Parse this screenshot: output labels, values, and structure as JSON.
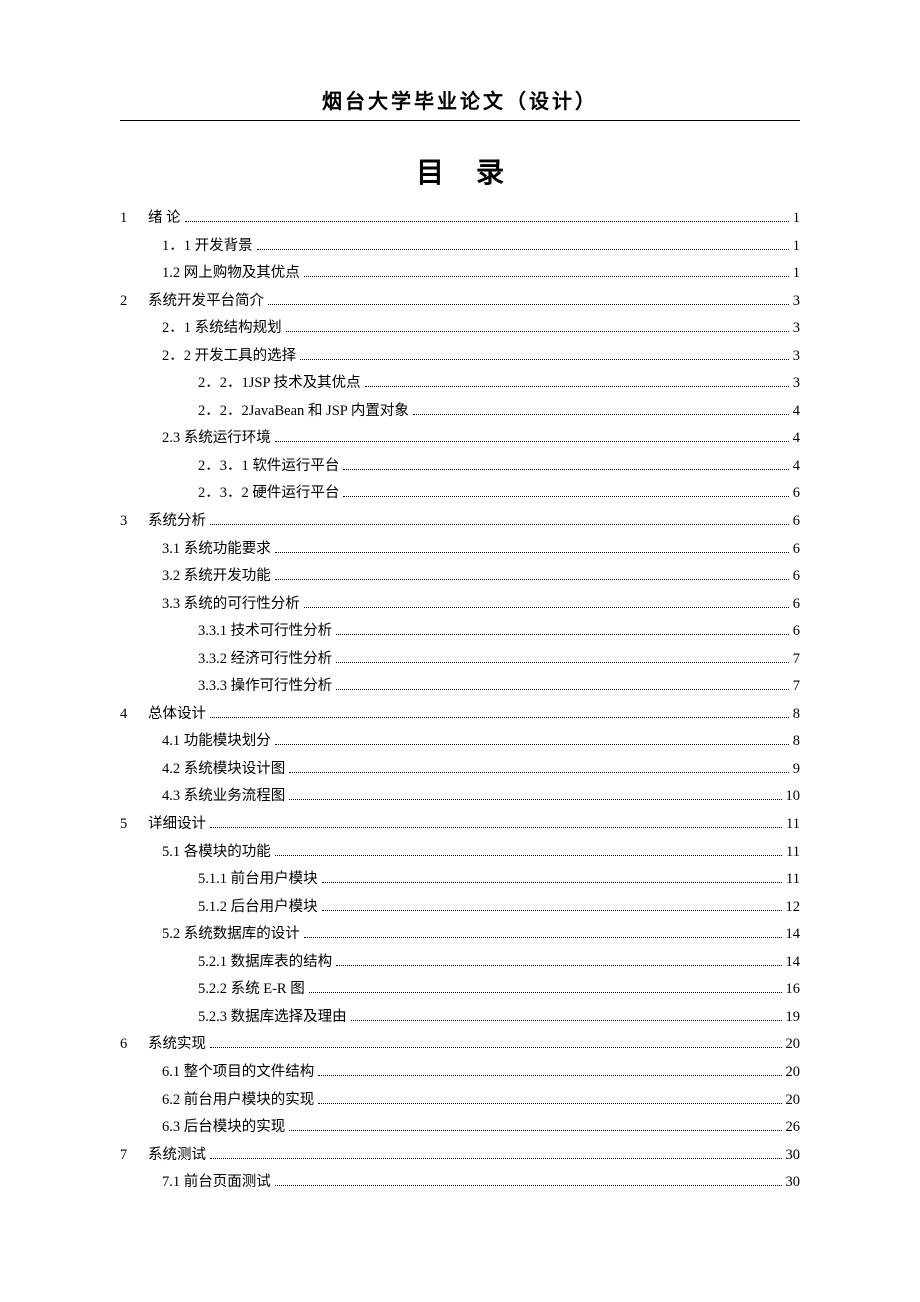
{
  "header": "烟台大学毕业论文（设计）",
  "title": "目录",
  "toc": [
    {
      "level": 1,
      "num": "1",
      "label": "绪 论",
      "page": "1"
    },
    {
      "level": 2,
      "label": "1．1  开发背景",
      "page": "1"
    },
    {
      "level": 2,
      "label": "1.2  网上购物及其优点",
      "page": "1"
    },
    {
      "level": 1,
      "num": "2",
      "label": "系统开发平台简介",
      "page": "3"
    },
    {
      "level": 2,
      "label": "2．1  系统结构规划",
      "page": "3"
    },
    {
      "level": 2,
      "label": "2．2  开发工具的选择",
      "page": "3"
    },
    {
      "level": 3,
      "label": "2．2．1JSP 技术及其优点",
      "page": "3"
    },
    {
      "level": 3,
      "label": "2．2．2JavaBean 和 JSP 内置对象",
      "page": "4"
    },
    {
      "level": 2,
      "label": "2.3  系统运行环境",
      "page": "4"
    },
    {
      "level": 3,
      "label": "2．3．1 软件运行平台",
      "page": "4"
    },
    {
      "level": 3,
      "label": "2．3．2 硬件运行平台",
      "page": "6"
    },
    {
      "level": 1,
      "num": "3",
      "label": "系统分析",
      "page": "6"
    },
    {
      "level": 2,
      "label": "3.1  系统功能要求",
      "page": "6"
    },
    {
      "level": 2,
      "label": "3.2  系统开发功能",
      "page": "6"
    },
    {
      "level": 2,
      "label": "3.3  系统的可行性分析",
      "page": "6"
    },
    {
      "level": 3,
      "label": "3.3.1  技术可行性分析",
      "page": "6"
    },
    {
      "level": 3,
      "label": "3.3.2 经济可行性分析",
      "page": "7"
    },
    {
      "level": 3,
      "label": "3.3.3 操作可行性分析",
      "page": "7"
    },
    {
      "level": 1,
      "num": "4",
      "label": "总体设计",
      "page": "8"
    },
    {
      "level": 2,
      "label": "4.1  功能模块划分",
      "page": "8"
    },
    {
      "level": 2,
      "label": "4.2  系统模块设计图",
      "page": "9"
    },
    {
      "level": 2,
      "label": "4.3  系统业务流程图",
      "page": "10"
    },
    {
      "level": 1,
      "num": "5",
      "label": "详细设计",
      "page": "11"
    },
    {
      "level": 2,
      "label": "5.1  各模块的功能",
      "page": "11"
    },
    {
      "level": 3,
      "label": "5.1.1  前台用户模块",
      "page": "11"
    },
    {
      "level": 3,
      "label": "5.1.2  后台用户模块",
      "page": "12"
    },
    {
      "level": 2,
      "label": "5.2  系统数据库的设计",
      "page": "14"
    },
    {
      "level": 3,
      "label": "5.2.1  数据库表的结构",
      "page": "14"
    },
    {
      "level": 3,
      "label": "5.2.2  系统 E-R 图",
      "page": "16"
    },
    {
      "level": 3,
      "label": "5.2.3  数据库选择及理由",
      "page": "19"
    },
    {
      "level": 1,
      "num": "6",
      "label": "系统实现",
      "page": "20"
    },
    {
      "level": 2,
      "label": "6.1 整个项目的文件结构",
      "page": "20"
    },
    {
      "level": 2,
      "label": "6.2 前台用户模块的实现",
      "page": "20"
    },
    {
      "level": 2,
      "label": "6.3 后台模块的实现",
      "page": "26"
    },
    {
      "level": 1,
      "num": "7",
      "label": "系统测试",
      "page": "30"
    },
    {
      "level": 2,
      "label": "7.1 前台页面测试",
      "page": "30"
    }
  ]
}
